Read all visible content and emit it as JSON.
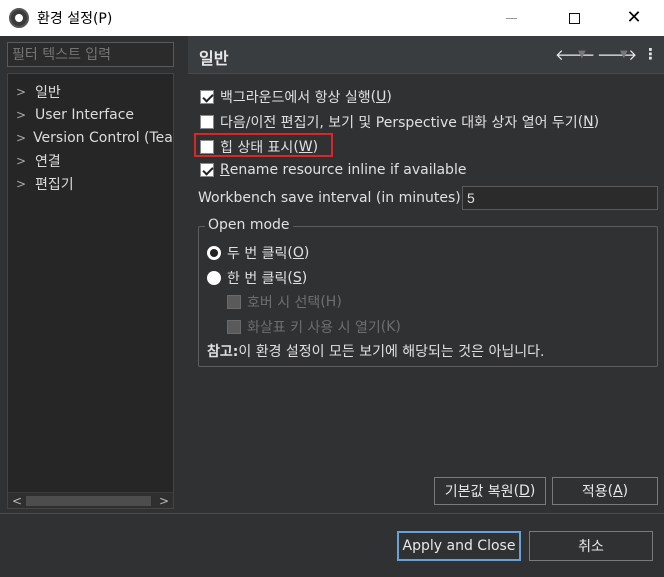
{
  "window": {
    "title": "환경 설정(P)"
  },
  "left": {
    "filter_placeholder": "필터 텍스트 입력",
    "tree": [
      "일반",
      "User Interface",
      "Version Control (Team)",
      "연결",
      "편집기"
    ]
  },
  "right": {
    "header_title": "일반",
    "options": [
      {
        "label": "백그라운드에서 항상 실행",
        "mnemonic": "U",
        "checked": true
      },
      {
        "label": "다음/이전 편집기, 보기 및 Perspective 대화 상자 열어 두기",
        "mnemonic": "N",
        "checked": false
      },
      {
        "label": "힙 상태 표시",
        "mnemonic": "W",
        "checked": false
      },
      {
        "label_prefix": "",
        "mnemonic": "R",
        "label_rest": "ename resource inline if available",
        "checked": true
      }
    ],
    "interval_label": "Workbench save interval (in minutes):",
    "interval_value": "5",
    "open_mode": {
      "label": "Open mode",
      "double_click": {
        "label": "두 번 클릭",
        "mnemonic": "O"
      },
      "single_click": {
        "label": "한 번 클릭",
        "mnemonic": "S"
      },
      "hover_select": {
        "label": "호버 시 선택",
        "mnemonic": "H"
      },
      "arrow_open": {
        "label": "화살표 키 사용 시 열기",
        "mnemonic": "K"
      },
      "note_bold": "참고:",
      "note_text": " 이 환경 설정이 모든 보기에 해당되는 것은 아닙니다."
    },
    "restore_defaults": {
      "label": "기본값 복원",
      "mnemonic": "D"
    },
    "apply": {
      "label": "적용",
      "mnemonic": "A"
    }
  },
  "footer": {
    "apply_close": "Apply and Close",
    "cancel": "취소"
  }
}
